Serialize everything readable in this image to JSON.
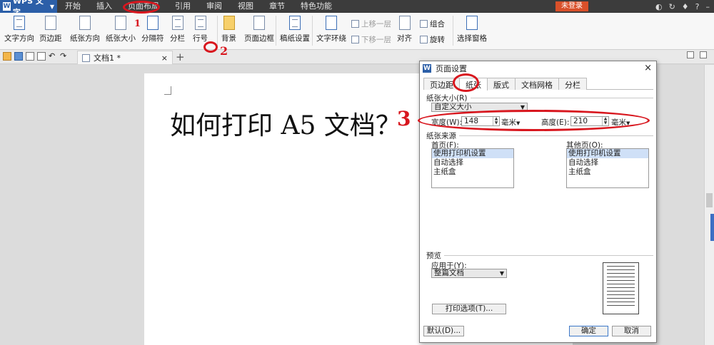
{
  "app": {
    "name": "WPS 文字",
    "logo": "W"
  },
  "menus": [
    "开始",
    "插入",
    "页面布局",
    "引用",
    "审阅",
    "视图",
    "章节",
    "特色功能"
  ],
  "login_button": "未登录",
  "ribbon": {
    "text_direction": "文字方向",
    "margins": "页边距",
    "orientation": "纸张方向",
    "paper_size": "纸张大小",
    "separator": "分隔符",
    "columns": "分栏",
    "line_numbers": "行号",
    "background": "背景",
    "page_border": "页面边框",
    "manuscript": "稿纸设置",
    "text_wrap": "文字环绕",
    "bring_forward": "上移一层",
    "send_backward": "下移一层",
    "align": "对齐",
    "group": "组合",
    "rotate": "旋转",
    "selection_pane": "选择窗格"
  },
  "tabs": {
    "doc_title": "文档1 *",
    "close": "×",
    "add": "+"
  },
  "document": {
    "text": "如何打印 A5 文档？"
  },
  "dialog": {
    "title": "页面设置",
    "close": "×",
    "tabs": [
      "页边距",
      "纸张",
      "版式",
      "文档网格",
      "分栏"
    ],
    "paper_size_label": "纸张大小(R)",
    "paper_size_value": "自定义大小",
    "width_label": "宽度(W):",
    "width_value": "148",
    "width_unit": "毫米",
    "height_label": "高度(E):",
    "height_value": "210",
    "height_unit": "毫米",
    "paper_source_label": "纸张来源",
    "first_page_label": "首页(F):",
    "other_pages_label": "其他页(O):",
    "source_options": [
      "使用打印机设置",
      "自动选择",
      "主纸盒"
    ],
    "preview_label": "预览",
    "apply_to_label": "应用于(Y):",
    "apply_to_value": "整篇文档",
    "print_options_button": "打印选项(T)...",
    "default_button": "默认(D)...",
    "ok_button": "确定",
    "cancel_button": "取消"
  },
  "annotations": {
    "step1": "1",
    "step2": "2",
    "step3": "3"
  },
  "colors": {
    "titlebar": "#3c3c3c",
    "app_button": "#2c5fa8",
    "login": "#d9502a",
    "annotation": "#d8161e"
  }
}
